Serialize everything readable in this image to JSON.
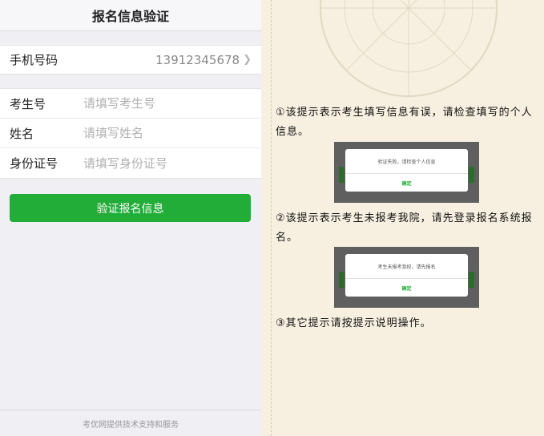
{
  "phone": {
    "title": "报名信息验证",
    "mobile": {
      "label": "手机号码",
      "value": "13912345678"
    },
    "fields": [
      {
        "label": "考生号",
        "placeholder": "请填写考生号"
      },
      {
        "label": "姓名",
        "placeholder": "请填写姓名"
      },
      {
        "label": "身份证号",
        "placeholder": "请填写身份证号"
      }
    ],
    "submit_label": "验证报名信息",
    "footer": "考优网提供技术支持和服务"
  },
  "instructions": {
    "item1": "①该提示表示考生填写信息有误，请检查填写的个人信息。",
    "dialog1": {
      "message": "验证失败，请检查个人信息",
      "ok": "确定"
    },
    "item2": "②该提示表示考生未报考我院，请先登录报名系统报名。",
    "dialog2": {
      "message": "考生未报考我校，请先报名",
      "ok": "确定"
    },
    "item3": "③其它提示请按提示说明操作。"
  },
  "colors": {
    "accent": "#22ac38",
    "page_background": "#f7f0e1"
  }
}
